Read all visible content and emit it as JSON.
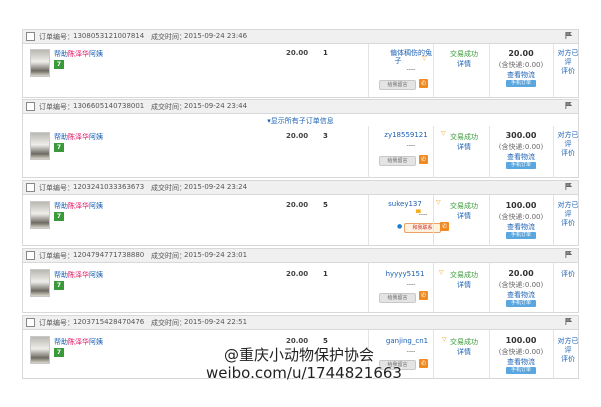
{
  "labels": {
    "order_number": "订单编号：",
    "deal_time": "成交时间：",
    "expand_sub_orders": "显示所有子订单信息",
    "leave_message": "给我留言",
    "contact_me": "和我联系",
    "trade_success": "交易成功",
    "details": "详情",
    "view_logistics": "查看物流",
    "phone_order": "手机订单",
    "dashes": "----",
    "seven_day_badge": "7"
  },
  "orders": [
    {
      "order_no": "1308053121007814",
      "time": "2015-09-24 23:46",
      "product_prefix": "帮助",
      "product_highlight": "陈泽华",
      "product_suffix": "阿姨",
      "price": "20.00",
      "qty": "1",
      "buyer_line1": "偏体稠伤的兔",
      "buyer_line2": "子",
      "total": "20.00",
      "shipping": "(含快递:0.00)",
      "rating_line1": "对方已评",
      "rating_line2": "评价"
    },
    {
      "order_no": "1306605140738001",
      "time": "2015-09-24 23:44",
      "product_prefix": "帮助",
      "product_highlight": "陈泽华",
      "product_suffix": "阿姨",
      "price": "20.00",
      "qty": "3",
      "buyer_line1": "zy18559121",
      "buyer_line2": "",
      "total": "300.00",
      "shipping": "(含快递:0.00)",
      "rating_line1": "对方已评",
      "rating_line2": "评价"
    },
    {
      "order_no": "1203241033363673",
      "time": "2015-09-24 23:24",
      "product_prefix": "帮助",
      "product_highlight": "陈泽华",
      "product_suffix": "阿姨",
      "price": "20.00",
      "qty": "5",
      "buyer_line1": "sukey137",
      "buyer_line2": "",
      "total": "100.00",
      "shipping": "(含快递:0.00)",
      "rating_line1": "对方已评",
      "rating_line2": "评价"
    },
    {
      "order_no": "1204794771738880",
      "time": "2015-09-24 23:01",
      "product_prefix": "帮助",
      "product_highlight": "陈泽华",
      "product_suffix": "阿姨",
      "price": "20.00",
      "qty": "1",
      "buyer_line1": "hyyyy5151",
      "buyer_line2": "",
      "total": "20.00",
      "shipping": "(含快递:0.00)",
      "rating_line1": "评价",
      "rating_line2": ""
    },
    {
      "order_no": "1203715428470476",
      "time": "2015-09-24 22:51",
      "product_prefix": "帮助",
      "product_highlight": "陈泽华",
      "product_suffix": "阿姨",
      "price": "20.00",
      "qty": "5",
      "buyer_line1": "ganjing_cn1",
      "buyer_line2": "",
      "total": "100.00",
      "shipping": "(含快递:0.00)",
      "rating_line1": "对方已评",
      "rating_line2": "评价"
    }
  ],
  "watermark": {
    "line1": "@重庆小动物保护协会",
    "line2": "weibo.com/u/1744821663"
  },
  "colors": {
    "link": "#1a5fb4",
    "success": "#3a9a3a",
    "highlight": "#e0115f",
    "phone": "#f28a22"
  }
}
